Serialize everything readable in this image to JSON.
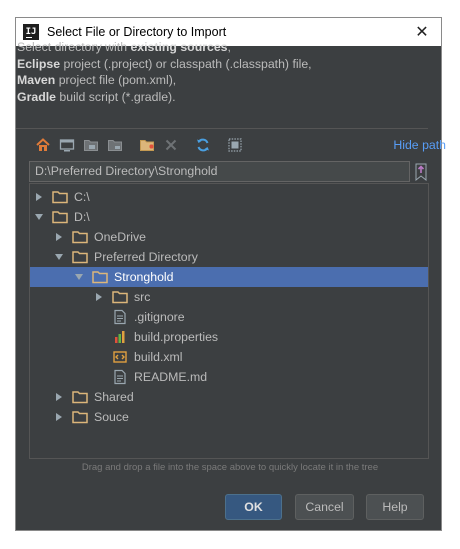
{
  "dialog": {
    "title": "Select File or Directory to Import",
    "app_icon_text": "IJ",
    "close_glyph": "✕"
  },
  "description": [
    [
      {
        "t": "Select directory with ",
        "b": false
      },
      {
        "t": "existing sources",
        "b": true
      },
      {
        "t": ",",
        "b": false
      }
    ],
    [
      {
        "t": "Eclipse",
        "b": true
      },
      {
        "t": " project (.project) or classpath (.classpath) file,",
        "b": false
      }
    ],
    [
      {
        "t": "Maven",
        "b": true
      },
      {
        "t": " project file (pom.xml),",
        "b": false
      }
    ],
    [
      {
        "t": "Gradle",
        "b": true
      },
      {
        "t": " build script (*.gradle).",
        "b": false
      }
    ]
  ],
  "toolbar": {
    "icons": [
      "home-icon",
      "desktop-icon",
      "project-folder-icon",
      "module-folder-icon",
      "new-folder-icon",
      "delete-icon",
      "refresh-icon",
      "show-hidden-icon"
    ],
    "hide_path": "Hide path"
  },
  "path": {
    "value": "D:\\Preferred Directory\\Stronghold"
  },
  "tree": [
    {
      "label": "C:\\",
      "depth": 0,
      "arrow": "right",
      "icon": "folder",
      "selected": false
    },
    {
      "label": "D:\\",
      "depth": 0,
      "arrow": "down",
      "icon": "folder",
      "selected": false
    },
    {
      "label": "OneDrive",
      "depth": 1,
      "arrow": "right",
      "icon": "folder",
      "selected": false
    },
    {
      "label": "Preferred Directory",
      "depth": 1,
      "arrow": "down",
      "icon": "folder",
      "selected": false
    },
    {
      "label": "Stronghold",
      "depth": 2,
      "arrow": "down",
      "icon": "folder",
      "selected": true
    },
    {
      "label": "src",
      "depth": 3,
      "arrow": "right",
      "icon": "folder",
      "selected": false
    },
    {
      "label": ".gitignore",
      "depth": 3,
      "arrow": "none",
      "icon": "text-file",
      "selected": false
    },
    {
      "label": "build.properties",
      "depth": 3,
      "arrow": "none",
      "icon": "properties-file",
      "selected": false
    },
    {
      "label": "build.xml",
      "depth": 3,
      "arrow": "none",
      "icon": "xml-file",
      "selected": false
    },
    {
      "label": "README.md",
      "depth": 3,
      "arrow": "none",
      "icon": "text-file",
      "selected": false
    },
    {
      "label": "Shared",
      "depth": 1,
      "arrow": "right",
      "icon": "folder",
      "selected": false
    },
    {
      "label": "Souce",
      "depth": 1,
      "arrow": "right",
      "icon": "folder",
      "selected": false
    }
  ],
  "hint": "Drag and drop a file into the space above to quickly locate it in the tree",
  "buttons": {
    "ok": "OK",
    "cancel": "Cancel",
    "help": "Help"
  },
  "colors": {
    "background": "#3c3f41",
    "selection": "#4b6eaf",
    "link": "#589df6",
    "folder": "#dcb67a"
  }
}
